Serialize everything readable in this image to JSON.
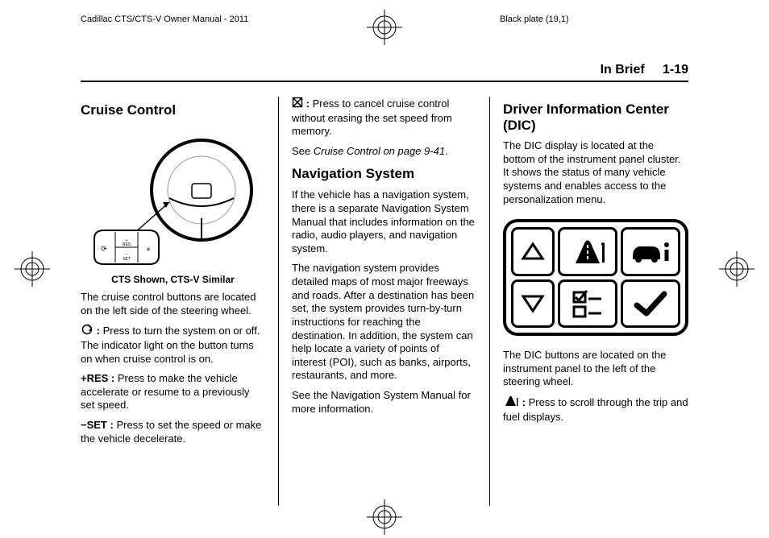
{
  "topbar": {
    "left": "Cadillac CTS/CTS-V Owner Manual - 2011",
    "right": "Black plate (19,1)"
  },
  "header": {
    "section": "In Brief",
    "pagenum": "1-19"
  },
  "col1": {
    "h_cruise": "Cruise Control",
    "fig_caption": "CTS Shown, CTS-V Similar",
    "p1": "The cruise control buttons are located on the left side of the steering wheel.",
    "onoff_label": " :",
    "onoff_body": "  Press to turn the system on or off. The indicator light on the button turns on when cruise control is on.",
    "res_label": "+RES :",
    "res_body": "  Press to make the vehicle accelerate or resume to a previously set speed.",
    "set_label": "−SET :",
    "set_body": "  Press to set the speed or make the vehicle decelerate."
  },
  "col2": {
    "cancel_label": " :",
    "cancel_body": "  Press to cancel cruise control without erasing the set speed from memory.",
    "see_cruise_pre": "See ",
    "see_cruise_ital": "Cruise Control on page 9-41",
    "see_cruise_post": ".",
    "h_nav": "Navigation System",
    "nav_p1": "If the vehicle has a navigation system, there is a separate Navigation System Manual that includes information on the radio, audio players, and navigation system.",
    "nav_p2": "The navigation system provides detailed maps of most major freeways and roads. After a destination has been set, the system provides turn-by-turn instructions for reaching the destination. In addition, the system can help locate a variety of points of interest (POI), such as banks, airports, restaurants, and more.",
    "nav_p3": "See the Navigation System Manual for more information."
  },
  "col3": {
    "h_dic": "Driver Information Center (DIC)",
    "dic_p1": "The DIC display is located at the bottom of the instrument panel cluster. It shows the status of many vehicle systems and enables access to the personalization menu.",
    "dic_p2": "The DIC buttons are located on the instrument panel to the left of the steering wheel.",
    "trip_label": " :",
    "trip_body": "  Press to scroll through the trip and fuel displays."
  }
}
